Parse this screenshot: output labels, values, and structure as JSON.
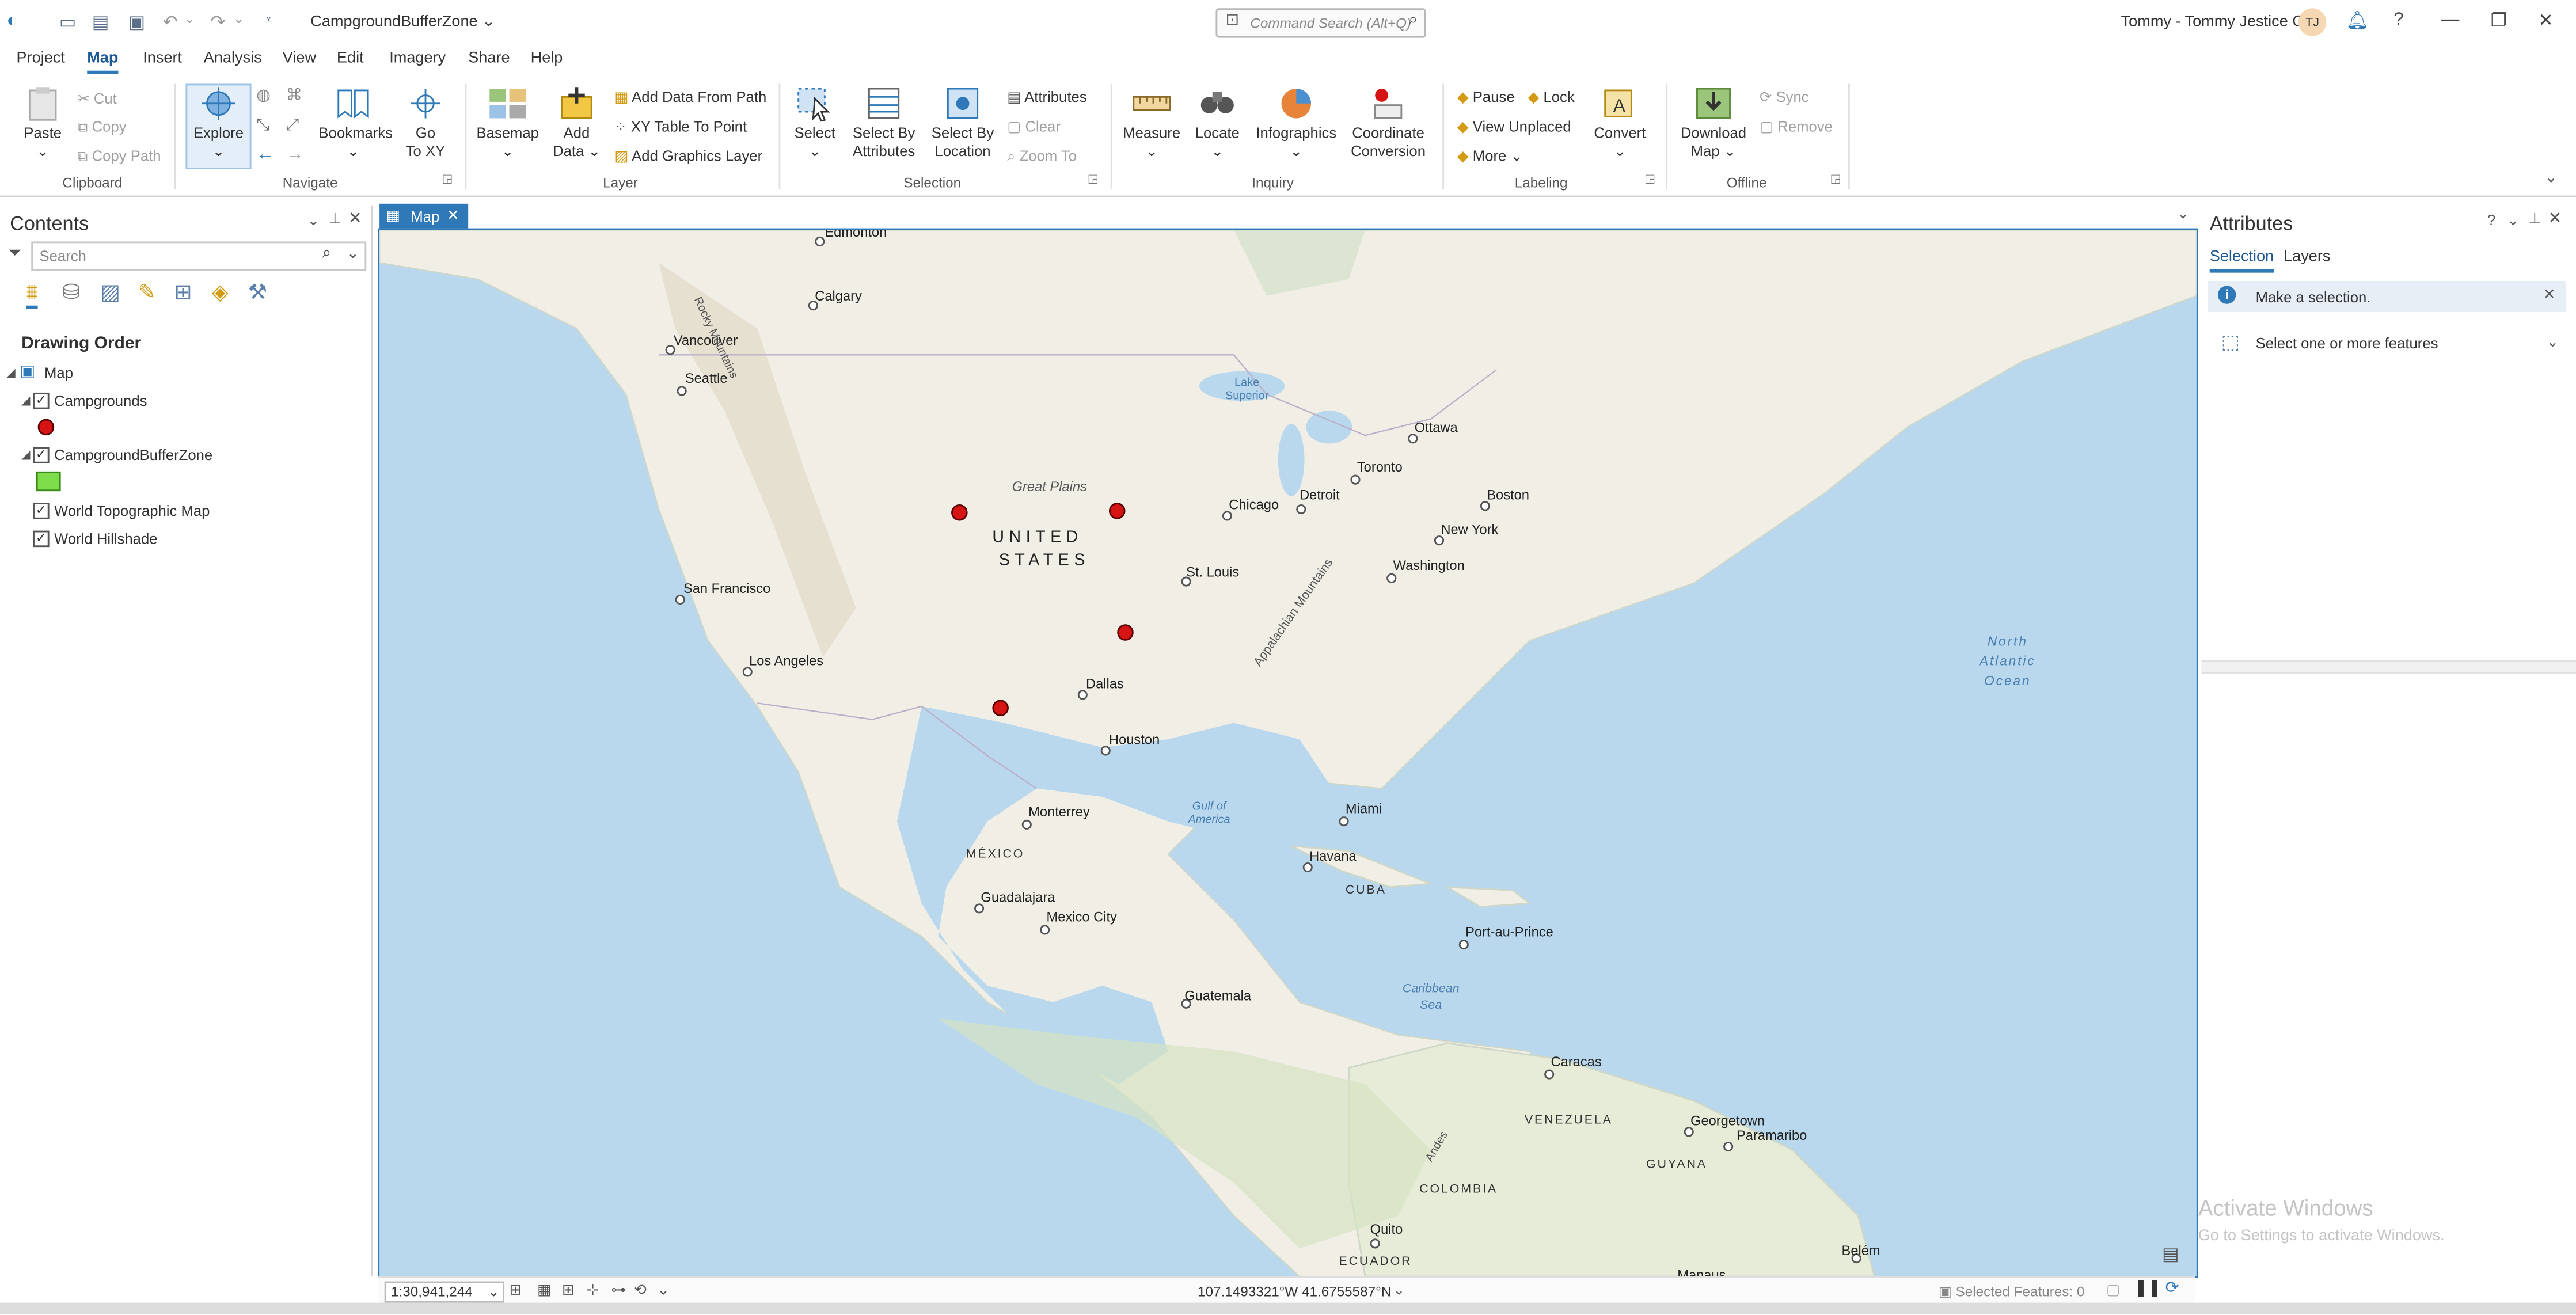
{
  "title_bar": {
    "project_name": "CampgroundBufferZone",
    "command_search_placeholder": "Command Search (Alt+Q)",
    "user_name": "Tommy - Tommy Jestice GIS",
    "user_initials": "TJ",
    "help": "?"
  },
  "menu_tabs": [
    "Project",
    "Map",
    "Insert",
    "Analysis",
    "View",
    "Edit",
    "Imagery",
    "Share",
    "Help"
  ],
  "ribbon": {
    "clipboard": {
      "paste": "Paste",
      "cut": "Cut",
      "copy": "Copy",
      "copy_path": "Copy Path",
      "group": "Clipboard"
    },
    "navigate": {
      "explore": "Explore",
      "bookmarks": "Bookmarks",
      "go_to_xy_1": "Go",
      "go_to_xy_2": "To XY",
      "group": "Navigate"
    },
    "layer": {
      "basemap": "Basemap",
      "add_data_1": "Add",
      "add_data_2": "Data",
      "add_from_path": "Add Data From Path",
      "xy_table": "XY Table To Point",
      "add_graphics": "Add Graphics Layer",
      "group": "Layer"
    },
    "selection": {
      "select": "Select",
      "by_attr_1": "Select By",
      "by_attr_2": "Attributes",
      "by_loc_1": "Select By",
      "by_loc_2": "Location",
      "attributes": "Attributes",
      "clear": "Clear",
      "zoom_to": "Zoom To",
      "group": "Selection"
    },
    "inquiry": {
      "measure": "Measure",
      "locate": "Locate",
      "infographics": "Infographics",
      "coord_1": "Coordinate",
      "coord_2": "Conversion",
      "group": "Inquiry"
    },
    "labeling": {
      "pause": "Pause",
      "lock": "Lock",
      "view_unplaced": "View Unplaced",
      "more": "More",
      "convert": "Convert",
      "group": "Labeling"
    },
    "offline": {
      "download_1": "Download",
      "download_2": "Map",
      "sync": "Sync",
      "remove": "Remove",
      "group": "Offline"
    }
  },
  "contents": {
    "title": "Contents",
    "search_placeholder": "Search",
    "drawing_order": "Drawing Order",
    "map_label": "Map",
    "layers": [
      "Campgrounds",
      "CampgroundBufferZone",
      "World Topographic Map",
      "World Hillshade"
    ]
  },
  "map_view": {
    "tab_label": "Map",
    "scale": "1:30,941,244",
    "coordinates": "107.1493321°W 41.6755587°N",
    "selected_features": "Selected Features: 0",
    "country_label_1": "UNITED",
    "country_label_2": "STATES",
    "places": [
      {
        "name": "Edmonton"
      },
      {
        "name": "Calgary"
      },
      {
        "name": "Vancouver"
      },
      {
        "name": "Seattle"
      },
      {
        "name": "San Francisco"
      },
      {
        "name": "Los Angeles"
      },
      {
        "name": "Dallas"
      },
      {
        "name": "Houston"
      },
      {
        "name": "St. Louis"
      },
      {
        "name": "Chicago"
      },
      {
        "name": "Detroit"
      },
      {
        "name": "Toronto"
      },
      {
        "name": "Ottawa"
      },
      {
        "name": "Boston"
      },
      {
        "name": "New York"
      },
      {
        "name": "Washington"
      },
      {
        "name": "Miami"
      },
      {
        "name": "Havana"
      },
      {
        "name": "Monterrey"
      },
      {
        "name": "Guadalajara"
      },
      {
        "name": "Mexico City"
      },
      {
        "name": "Guatemala"
      },
      {
        "name": "Port-au-Prince"
      },
      {
        "name": "Caracas"
      },
      {
        "name": "Georgetown"
      },
      {
        "name": "Paramaribo"
      },
      {
        "name": "Quito"
      },
      {
        "name": "Belém"
      },
      {
        "name": "Manaus"
      }
    ],
    "region_labels": [
      "Great Plains",
      "Rocky Mountains",
      "Lake Superior",
      "Appalachian Mountains",
      "Gulf of America",
      "CUBA",
      "MÉXICO",
      "Caribbean Sea",
      "North Atlantic Ocean",
      "VENEZUELA",
      "GUYANA",
      "COLOMBIA",
      "ECUADOR",
      "Andes"
    ],
    "campground_count": 4
  },
  "attributes": {
    "title": "Attributes",
    "tabs": [
      "Selection",
      "Layers"
    ],
    "message": "Make a selection.",
    "select_prompt": "Select one or more features"
  },
  "watermark": {
    "line1": "Activate Windows",
    "line2": "Go to Settings to activate Windows."
  },
  "colors": {
    "accent": "#2f79b9",
    "campground_fill": "#d71414",
    "buffer_fill": "#7fdc4a",
    "water": "#b9d8ee",
    "land": "#f1eee6"
  }
}
